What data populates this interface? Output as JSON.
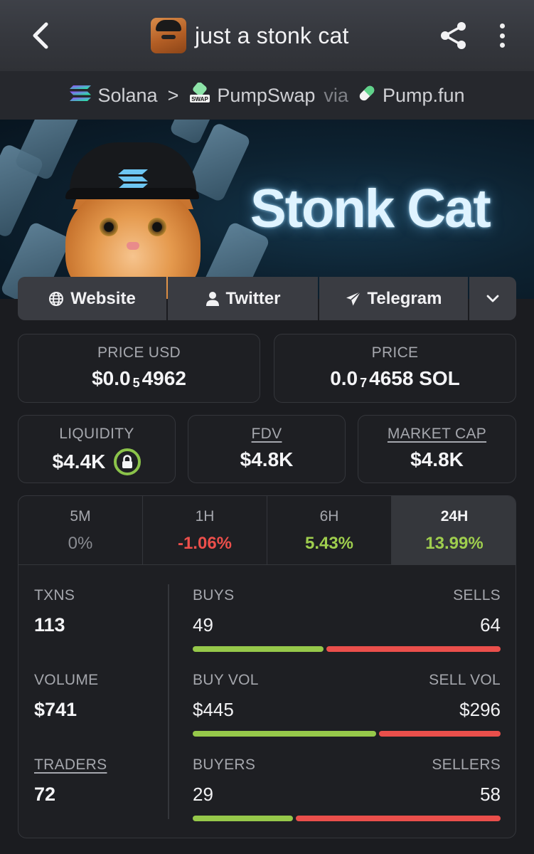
{
  "header": {
    "title": "just a stonk cat",
    "back_icon": "chevron-left-icon",
    "share_icon": "share-icon",
    "more_icon": "more-vertical-icon"
  },
  "breadcrumb": {
    "chain": "Solana",
    "separator": ">",
    "dex": "PumpSwap",
    "dex_badge": "SWAP",
    "via": "via",
    "launchpad": "Pump.fun"
  },
  "banner": {
    "title": "Stonk Cat"
  },
  "links": [
    {
      "label": "Website",
      "icon": "globe-icon"
    },
    {
      "label": "Twitter",
      "icon": "user-icon"
    },
    {
      "label": "Telegram",
      "icon": "send-icon"
    },
    {
      "label": "",
      "icon": "chevron-down-icon"
    }
  ],
  "price": {
    "usd_label": "PRICE USD",
    "usd_prefix": "$0.0",
    "usd_zeros": "5",
    "usd_digits": "4962",
    "native_label": "PRICE",
    "native_prefix": "0.0",
    "native_zeros": "7",
    "native_digits": "4658 SOL"
  },
  "stats": {
    "liquidity_label": "LIQUIDITY",
    "liquidity_value": "$4.4K",
    "fdv_label": "FDV",
    "fdv_value": "$4.8K",
    "mcap_label": "MARKET CAP",
    "mcap_value": "$4.8K"
  },
  "timeframes": [
    {
      "label": "5M",
      "change": "0%"
    },
    {
      "label": "1H",
      "change": "-1.06%"
    },
    {
      "label": "6H",
      "change": "5.43%"
    },
    {
      "label": "24H",
      "change": "13.99%"
    }
  ],
  "activity": {
    "txns_label": "TXNS",
    "txns_value": "113",
    "buys_label": "BUYS",
    "buys_value": "49",
    "sells_label": "SELLS",
    "sells_value": "64",
    "volume_label": "VOLUME",
    "volume_value": "$741",
    "buy_vol_label": "BUY VOL",
    "buy_vol_value": "$445",
    "sell_vol_label": "SELL VOL",
    "sell_vol_value": "$296",
    "traders_label": "TRADERS",
    "traders_value": "72",
    "buyers_label": "BUYERS",
    "buyers_value": "29",
    "sellers_label": "SELLERS",
    "sellers_value": "58"
  },
  "ratios": {
    "buys_fraction": 0.43,
    "buy_vol_fraction": 0.6,
    "buyers_fraction": 0.33
  },
  "colors": {
    "positive": "#9fce4e",
    "negative": "#ec4f4b",
    "bar_green": "#96c84a",
    "bar_red": "#ea4f4b",
    "background": "#1b1c20"
  }
}
